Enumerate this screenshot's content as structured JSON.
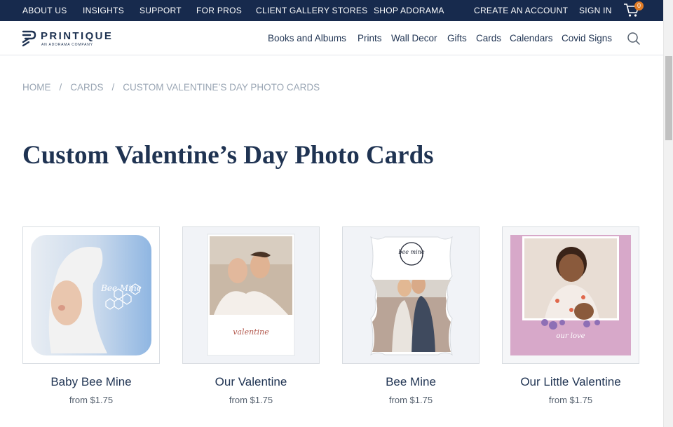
{
  "topbar": {
    "links": [
      {
        "label": "ABOUT US",
        "name": "topbar-about-us"
      },
      {
        "label": "INSIGHTS",
        "name": "topbar-insights"
      },
      {
        "label": "SUPPORT",
        "name": "topbar-support"
      },
      {
        "label": "FOR PROS",
        "name": "topbar-for-pros"
      },
      {
        "label": "CLIENT GALLERY STORES",
        "name": "topbar-client-gallery-stores"
      },
      {
        "label": "SHOP ADORAMA",
        "name": "topbar-shop-adorama"
      },
      {
        "label": "CREATE AN ACCOUNT",
        "name": "topbar-create-account"
      },
      {
        "label": "SIGN IN",
        "name": "topbar-sign-in"
      }
    ],
    "cart_count": "0",
    "bg_color": "#172a4d",
    "badge_color": "#e07b25"
  },
  "header": {
    "logo_word": "PRINTIQUE",
    "logo_sub": "AN ADORAMA COMPANY",
    "nav": [
      {
        "label": "Books and Albums",
        "name": "nav-books-and-albums"
      },
      {
        "label": "Prints",
        "name": "nav-prints"
      },
      {
        "label": "Wall Decor",
        "name": "nav-wall-decor"
      },
      {
        "label": "Gifts",
        "name": "nav-gifts"
      },
      {
        "label": "Cards",
        "name": "nav-cards"
      },
      {
        "label": "Calendars",
        "name": "nav-calendars"
      },
      {
        "label": "Covid Signs",
        "name": "nav-covid-signs"
      }
    ]
  },
  "breadcrumb": [
    "HOME",
    "CARDS",
    "CUSTOM VALENTINE’S DAY PHOTO CARDS"
  ],
  "page_title": "Custom Valentine’s Day Photo Cards",
  "products": [
    {
      "name": "Baby Bee Mine",
      "price": "from $1.75",
      "card_text": "Bee Mine"
    },
    {
      "name": "Our Valentine",
      "price": "from $1.75",
      "card_text": "valentine"
    },
    {
      "name": "Bee Mine",
      "price": "from $1.75",
      "card_text": "bee mine"
    },
    {
      "name": "Our Little Valentine",
      "price": "from $1.75",
      "card_text": "our love"
    }
  ]
}
